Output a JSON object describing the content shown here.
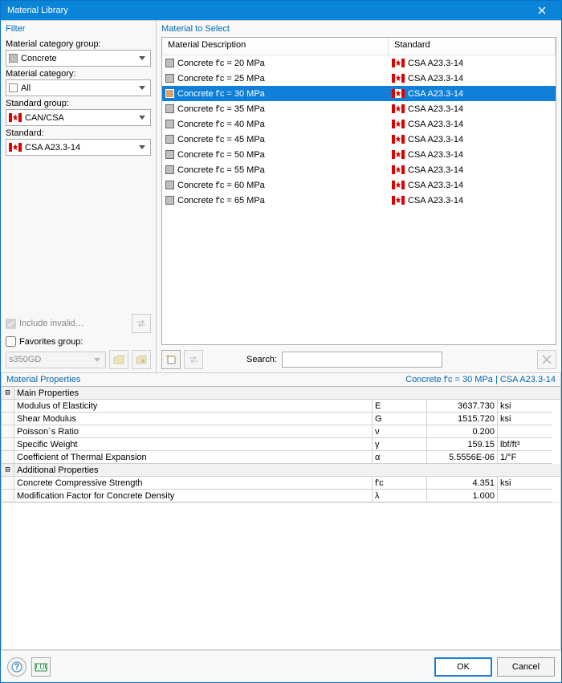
{
  "window": {
    "title": "Material Library"
  },
  "filter": {
    "panel_title": "Filter",
    "category_group_label": "Material category group:",
    "category_group": "Concrete",
    "category_group_swatch": "#bfbfbf",
    "category_label": "Material category:",
    "category": "All",
    "standard_group_label": "Standard group:",
    "standard_group": "CAN/CSA",
    "standard_label": "Standard:",
    "standard": "CSA A23.3-14",
    "include_invalid_label": "Include invalid…",
    "favorites_label": "Favorites group:",
    "favorites_value": "s350GD"
  },
  "select": {
    "panel_title": "Material to Select",
    "col_desc": "Material Description",
    "col_std": "Standard",
    "rows": [
      {
        "desc": "Concrete f'c = 20 MPa",
        "std": "CSA A23.3-14",
        "selected": false
      },
      {
        "desc": "Concrete f'c = 25 MPa",
        "std": "CSA A23.3-14",
        "selected": false
      },
      {
        "desc": "Concrete f'c = 30 MPa",
        "std": "CSA A23.3-14",
        "selected": true
      },
      {
        "desc": "Concrete f'c = 35 MPa",
        "std": "CSA A23.3-14",
        "selected": false
      },
      {
        "desc": "Concrete f'c = 40 MPa",
        "std": "CSA A23.3-14",
        "selected": false
      },
      {
        "desc": "Concrete f'c = 45 MPa",
        "std": "CSA A23.3-14",
        "selected": false
      },
      {
        "desc": "Concrete f'c = 50 MPa",
        "std": "CSA A23.3-14",
        "selected": false
      },
      {
        "desc": "Concrete f'c = 55 MPa",
        "std": "CSA A23.3-14",
        "selected": false
      },
      {
        "desc": "Concrete f'c = 60 MPa",
        "std": "CSA A23.3-14",
        "selected": false
      },
      {
        "desc": "Concrete f'c = 65 MPa",
        "std": "CSA A23.3-14",
        "selected": false
      }
    ],
    "search_label": "Search:",
    "search_value": ""
  },
  "props": {
    "panel_title": "Material Properties",
    "info": "Concrete f'c = 30 MPa  |  CSA A23.3-14",
    "groups": [
      {
        "name": "Main Properties",
        "rows": [
          {
            "name": "Modulus of Elasticity",
            "sym": "E",
            "val": "3637.730",
            "unit": "ksi"
          },
          {
            "name": "Shear Modulus",
            "sym": "G",
            "val": "1515.720",
            "unit": "ksi"
          },
          {
            "name": "Poisson´s Ratio",
            "sym": "ν",
            "val": "0.200",
            "unit": ""
          },
          {
            "name": "Specific Weight",
            "sym": "γ",
            "val": "159.15",
            "unit": "lbf/ft³"
          },
          {
            "name": "Coefficient of Thermal Expansion",
            "sym": "α",
            "val": "5.5556E-06",
            "unit": "1/°F"
          }
        ]
      },
      {
        "name": "Additional Properties",
        "rows": [
          {
            "name": "Concrete Compressive Strength",
            "sym": "f'c",
            "val": "4.351",
            "unit": "ksi"
          },
          {
            "name": "Modification Factor for Concrete Density",
            "sym": "λ",
            "val": "1.000",
            "unit": ""
          }
        ]
      }
    ]
  },
  "buttons": {
    "ok": "OK",
    "cancel": "Cancel"
  }
}
